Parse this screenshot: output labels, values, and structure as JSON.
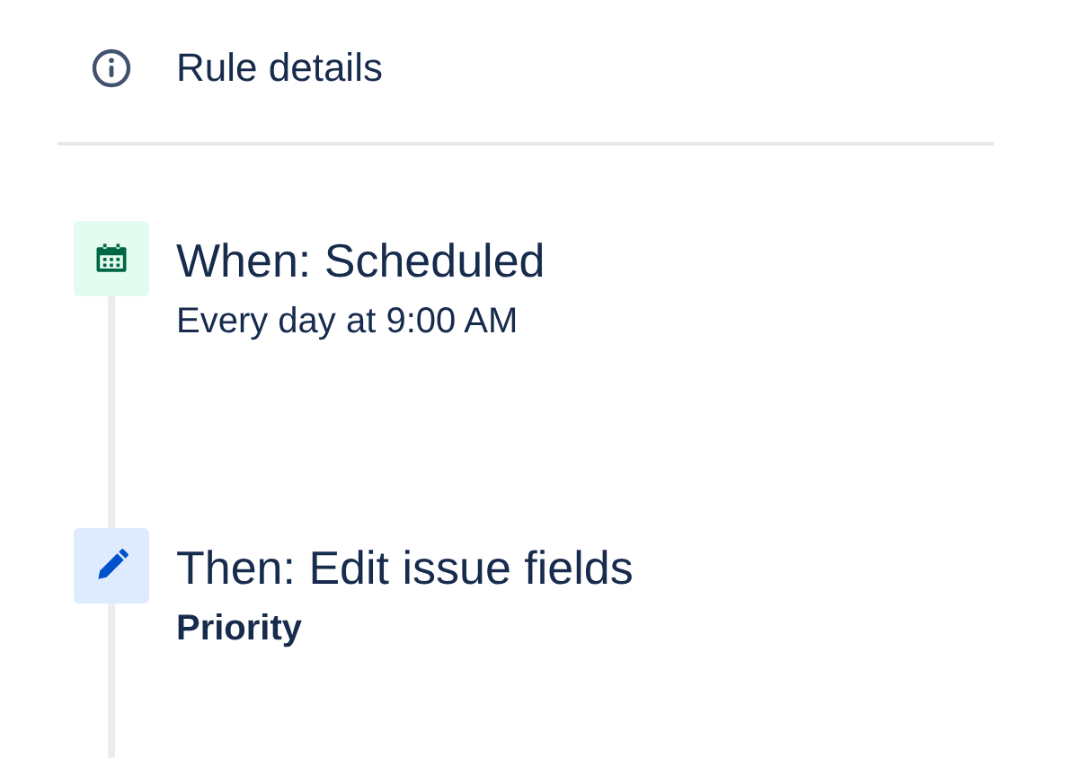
{
  "header": {
    "title": "Rule details"
  },
  "steps": [
    {
      "kind": "trigger",
      "title": "When: Scheduled",
      "detail": "Every day at 9:00 AM"
    },
    {
      "kind": "action",
      "title": "Then: Edit issue fields",
      "detail": "Priority"
    }
  ]
}
